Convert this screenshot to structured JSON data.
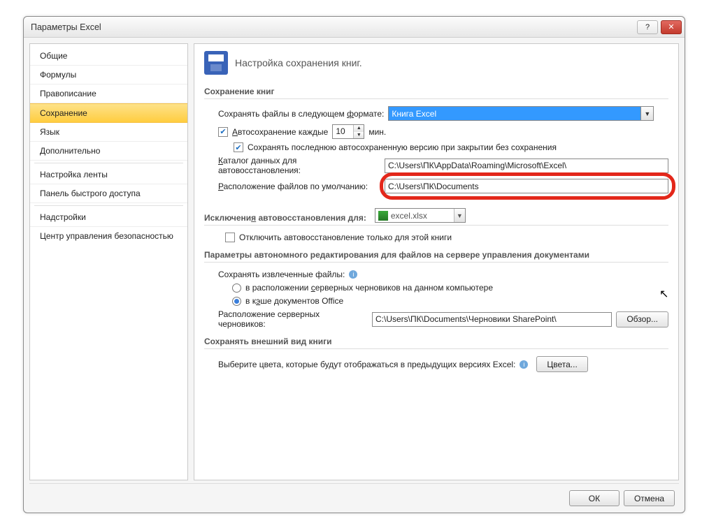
{
  "window": {
    "title": "Параметры Excel"
  },
  "sidebar": {
    "items": [
      {
        "label": "Общие"
      },
      {
        "label": "Формулы"
      },
      {
        "label": "Правописание"
      },
      {
        "label": "Сохранение",
        "selected": true
      },
      {
        "label": "Язык"
      },
      {
        "label": "Дополнительно"
      },
      {
        "label": "Настройка ленты"
      },
      {
        "label": "Панель быстрого доступа"
      },
      {
        "label": "Надстройки"
      },
      {
        "label": "Центр управления безопасностью"
      }
    ]
  },
  "content": {
    "heading": "Настройка сохранения книг.",
    "sec_save": {
      "title": "Сохранение книг",
      "format_label_pre": "Сохранять файлы в следующем ",
      "format_label_u": "ф",
      "format_label_post": "ормате:",
      "format_value": "Книга Excel",
      "autosave_label_u": "А",
      "autosave_label": "втосохранение каждые",
      "autosave_value": "10",
      "autosave_unit": "мин.",
      "keep_last": "Сохранять последнюю автосохраненную версию при закрытии без сохранения",
      "recover_dir_label_u": "К",
      "recover_dir_label": "аталог данных для автовосстановления:",
      "recover_dir_value": "C:\\Users\\ПК\\AppData\\Roaming\\Microsoft\\Excel\\",
      "default_loc_label_u": "Р",
      "default_loc_label": "асположение файлов по умолчанию:",
      "default_loc_value": "C:\\Users\\ПК\\Documents"
    },
    "sec_except": {
      "title_pre": "Исключени",
      "title_u": "я",
      "title_post": " автовосстановления для:",
      "file": "excel.xlsx",
      "disable": "Отключить автовосстановление только для этой книги"
    },
    "sec_offline": {
      "title": "Параметры автономного редактирования для файлов на сервере управления документами",
      "save_checked": "Сохранять извлеченные файлы:",
      "opt1_prefix": "в расположении ",
      "opt1_u": "с",
      "opt1_suffix": "ерверных черновиков на данном компьютере",
      "opt2_prefix": "в к",
      "opt2_u": "э",
      "opt2_suffix": "ше документов Office",
      "drafts_label": "Расположение серверных черновиков:",
      "drafts_value": "C:\\Users\\ПК\\Documents\\Черновики SharePoint\\",
      "browse": "Обзор..."
    },
    "sec_appearance": {
      "title": "Сохранять внешний вид книги",
      "colors_label": "Выберите цвета, которые будут отображаться в предыдущих версиях Excel:",
      "colors_btn": "Цвета..."
    }
  },
  "footer": {
    "ok": "ОК",
    "cancel": "Отмена"
  }
}
